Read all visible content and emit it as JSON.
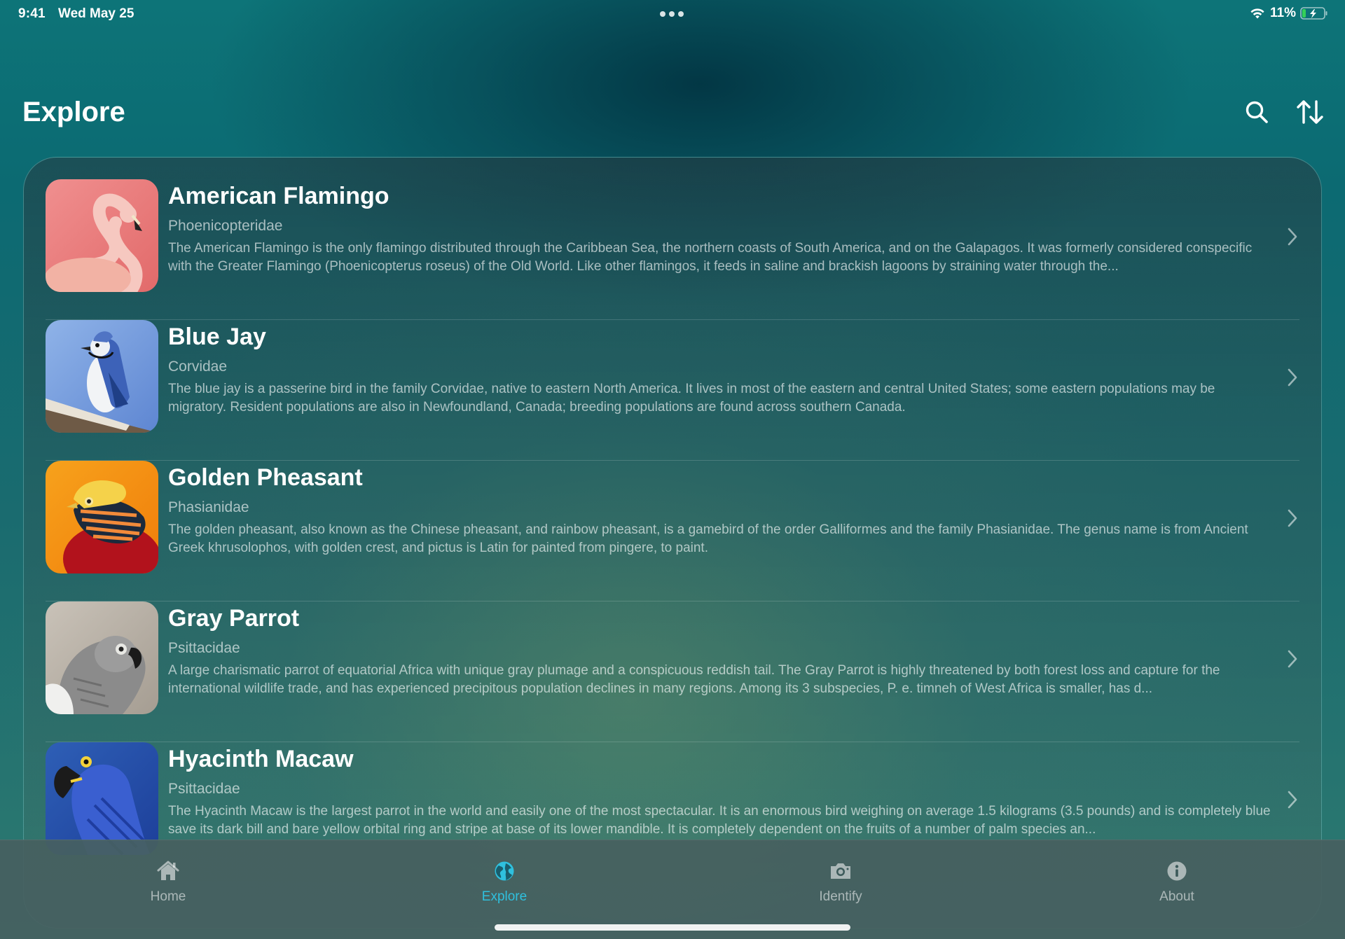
{
  "status_bar": {
    "time": "9:41",
    "date": "Wed May 25",
    "battery_percent": "11%"
  },
  "header": {
    "title": "Explore",
    "search_icon": "search-icon",
    "sort_icon": "sort-arrows-icon"
  },
  "birds": [
    {
      "name": "American Flamingo",
      "family": "Phoenicopteridae",
      "description": "The American Flamingo is the only flamingo distributed through the Caribbean Sea, the northern coasts of South America, and on the Galapagos. It was formerly considered conspecific with the Greater Flamingo (Phoenicopterus roseus) of the Old World. Like other flamingos, it feeds in saline and brackish lagoons by straining water through the..."
    },
    {
      "name": "Blue Jay",
      "family": "Corvidae",
      "description": "The blue jay is a passerine bird in the family Corvidae, native to eastern North America. It lives in most of the eastern and central United States; some eastern populations may be migratory. Resident populations are also in Newfoundland, Canada; breeding populations are found across southern Canada."
    },
    {
      "name": "Golden Pheasant",
      "family": "Phasianidae",
      "description": "The golden pheasant, also known as the Chinese pheasant, and rainbow pheasant, is a gamebird of the order Galliformes and the family Phasianidae. The genus name is from Ancient Greek khrusolophos, with golden crest, and pictus is Latin for painted from pingere, to paint."
    },
    {
      "name": "Gray Parrot",
      "family": "Psittacidae",
      "description": "A large charismatic parrot of equatorial Africa with unique gray plumage and a conspicuous reddish tail. The Gray Parrot is highly threatened by both forest loss and capture for the international wildlife trade, and has experienced precipitous population declines in many regions. Among its 3 subspecies, P. e. timneh of West Africa is smaller, has d..."
    },
    {
      "name": "Hyacinth Macaw",
      "family": "Psittacidae",
      "description": "The Hyacinth Macaw is the largest parrot in the world and easily one of the most spectacular. It is an enormous bird weighing on average 1.5 kilograms (3.5 pounds) and is completely blue save its dark bill and bare yellow orbital ring and stripe at base of its lower mandible. It is completely dependent on the fruits of a number of palm species an..."
    }
  ],
  "tabs": [
    {
      "label": "Home",
      "icon": "house-icon",
      "active": false
    },
    {
      "label": "Explore",
      "icon": "globe-icon",
      "active": true
    },
    {
      "label": "Identify",
      "icon": "camera-icon",
      "active": false
    },
    {
      "label": "About",
      "icon": "info-icon",
      "active": false
    }
  ],
  "colors": {
    "accent": "#2fc0de",
    "background": "#0d7478"
  }
}
